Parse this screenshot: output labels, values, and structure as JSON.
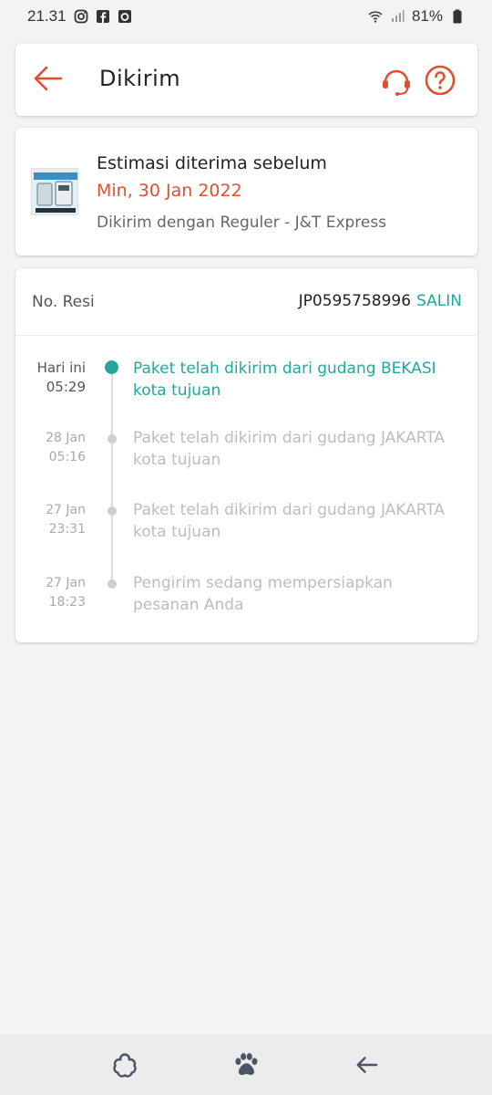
{
  "status_bar": {
    "time": "21.31",
    "battery": "81%",
    "icons": [
      "instagram-icon",
      "facebook-icon",
      "camera-app-icon",
      "wifi-icon",
      "signal-icon",
      "battery-icon"
    ]
  },
  "header": {
    "title": "Dikirim",
    "back_icon": "arrow-left-icon",
    "support_icon": "headset-icon",
    "help_icon": "question-circle-icon",
    "accent_color": "#e0502f"
  },
  "estimate": {
    "title": "Estimasi diterima sebelum",
    "date": "Min, 30 Jan 2022",
    "courier": "Dikirim dengan Reguler - J&T Express"
  },
  "tracking": {
    "resi_label": "No. Resi",
    "resi_number": "JP0595758996",
    "copy_label": "SALIN",
    "accent_color": "#26a69a",
    "events": [
      {
        "day": "Hari ini",
        "time": "05:29",
        "text": "Paket telah dikirim dari gudang BEKASI kota tujuan",
        "current": true
      },
      {
        "day": "28 Jan",
        "time": "05:16",
        "text": "Paket telah dikirim dari gudang JAKARTA kota tujuan",
        "current": false
      },
      {
        "day": "27 Jan",
        "time": "23:31",
        "text": "Paket telah dikirim dari gudang JAKARTA kota tujuan",
        "current": false
      },
      {
        "day": "27 Jan",
        "time": "18:23",
        "text": "Pengirim sedang mempersiapkan pesanan Anda",
        "current": false
      }
    ]
  },
  "nav_bar": {
    "icons": [
      "flower-icon",
      "paw-icon",
      "back-arrow-icon"
    ]
  }
}
